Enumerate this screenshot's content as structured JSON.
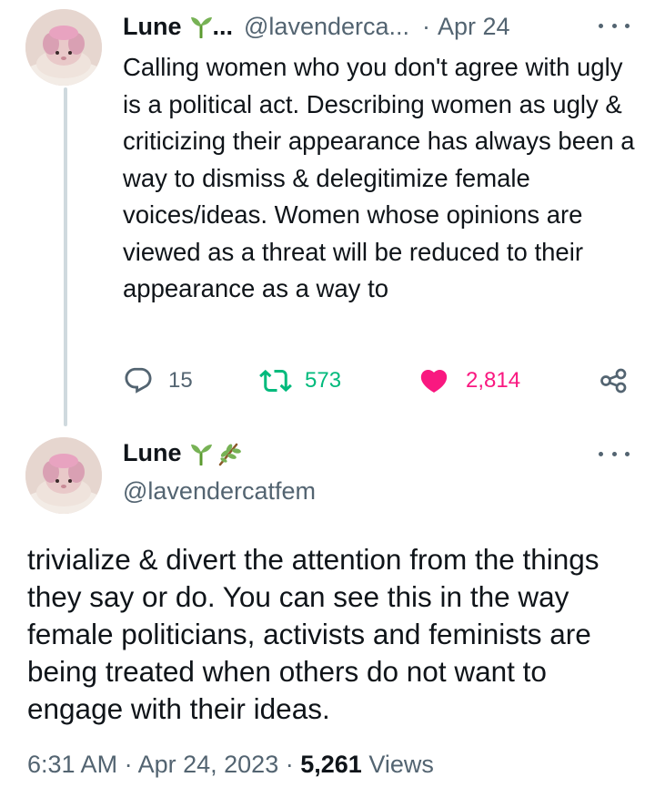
{
  "tweet1": {
    "name": "Lune",
    "name_truncation": "...",
    "handle": "@lavenderca...",
    "separator": "·",
    "date": "Apr 24",
    "text": "Calling women who you don't agree with ugly is a political act. Describing women as ugly & criticizing their appearance has always been a way to dismiss & delegitimize female voices/ideas. Women whose opinions are viewed as a threat will be reduced to their appearance as a way to",
    "replies": "15",
    "retweets": "573",
    "likes": "2,814",
    "name_emojis": [
      "seedling-emoji"
    ]
  },
  "tweet2": {
    "name": "Lune",
    "handle": "@lavendercatfem",
    "name_emojis": [
      "seedling-emoji",
      "herb-emoji"
    ],
    "text": "trivialize & divert the attention from the things they say or do. You can see this in the way female politicians, activists and feminists are being treated when others do not want to engage with their ideas.",
    "time": "6:31 AM",
    "date": "Apr 24, 2023",
    "views_count": "5,261",
    "views_label": "Views",
    "separator": "·"
  },
  "icons": {
    "reply": "reply-icon",
    "retweet": "retweet-icon",
    "like": "heart-icon",
    "share": "share-icon",
    "more": "more-icon"
  },
  "colors": {
    "text": "#0f1419",
    "secondary": "#536471",
    "retweet": "#00ba7c",
    "like": "#f91880",
    "thread_line": "#cfd9de"
  }
}
